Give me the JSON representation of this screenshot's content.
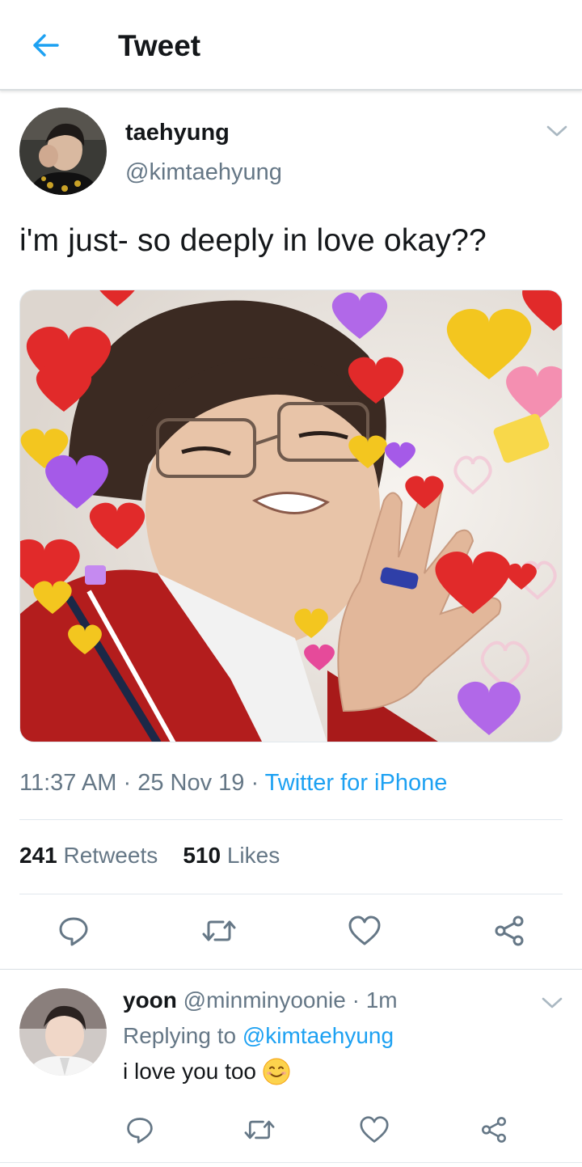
{
  "header": {
    "title": "Tweet"
  },
  "tweet": {
    "display_name": "taehyung",
    "handle": "@kimtaehyung",
    "text": "i'm just- so deeply in love okay??",
    "time": "11:37 AM",
    "date": "25 Nov 19",
    "source": "Twitter for iPhone",
    "sep": "·",
    "retweets_count": "241",
    "retweets_label": "Retweets",
    "likes_count": "510",
    "likes_label": "Likes"
  },
  "reply": {
    "display_name": "yoon",
    "handle": "@minminyoonie",
    "sep": "·",
    "time": "1m",
    "replying_label": "Replying to",
    "replying_handle": "@kimtaehyung",
    "text": "i love you too",
    "emoji": "smiling-face-emoji"
  },
  "colors": {
    "accent": "#1da1f2",
    "secondary_text": "#657786",
    "primary_text": "#14171a",
    "divider": "#e1e8ed"
  },
  "icons": [
    "back-arrow-icon",
    "chevron-down-icon",
    "reply-icon",
    "retweet-icon",
    "like-icon",
    "share-icon"
  ]
}
